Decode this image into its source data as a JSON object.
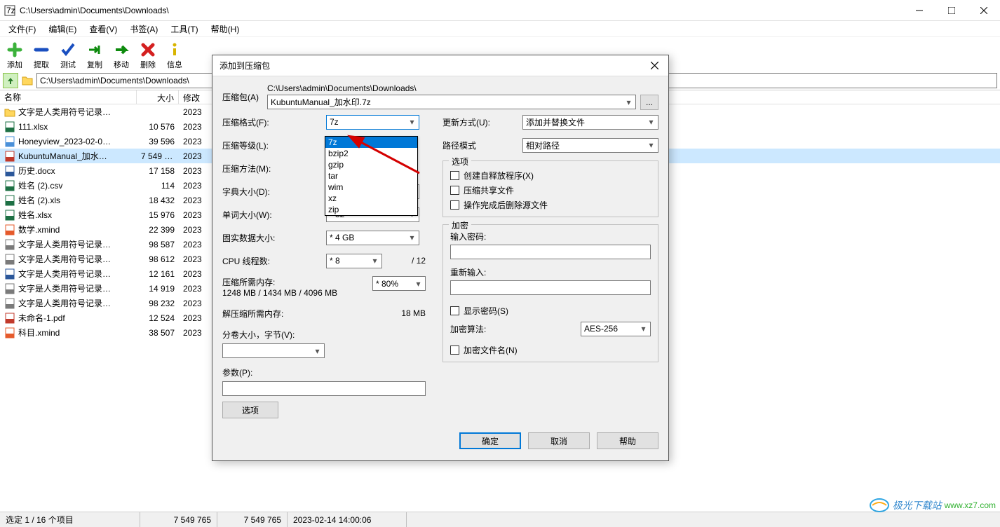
{
  "window": {
    "title": "C:\\Users\\admin\\Documents\\Downloads\\"
  },
  "menubar": [
    {
      "label": "文件(F)"
    },
    {
      "label": "编辑(E)"
    },
    {
      "label": "查看(V)"
    },
    {
      "label": "书签(A)"
    },
    {
      "label": "工具(T)"
    },
    {
      "label": "帮助(H)"
    }
  ],
  "toolbar": [
    {
      "label": "添加",
      "icon": "plus",
      "color": "#3bb13b"
    },
    {
      "label": "提取",
      "icon": "minus",
      "color": "#1a4fc0"
    },
    {
      "label": "测试",
      "icon": "check",
      "color": "#1a4fc0"
    },
    {
      "label": "复制",
      "icon": "copy",
      "color": "#0d8a0d"
    },
    {
      "label": "移动",
      "icon": "move",
      "color": "#0d8a0d"
    },
    {
      "label": "删除",
      "icon": "delete",
      "color": "#d42020"
    },
    {
      "label": "信息",
      "icon": "info",
      "color": "#d8b400"
    }
  ],
  "addressbar": {
    "path": "C:\\Users\\admin\\Documents\\Downloads\\"
  },
  "filelist": {
    "columns": [
      {
        "label": "名称",
        "key": "name"
      },
      {
        "label": "大小",
        "key": "size"
      },
      {
        "label": "修改时间",
        "key": "date"
      }
    ],
    "rows": [
      {
        "name": "文字是人类用符号记录…",
        "size": "",
        "date": "2023",
        "icon": "folder",
        "selected": false
      },
      {
        "name": "111.xlsx",
        "size": "10 576",
        "date": "2023",
        "icon": "xlsx",
        "selected": false
      },
      {
        "name": "Honeyview_2023-02-0…",
        "size": "39 596",
        "date": "2023",
        "icon": "image",
        "selected": false
      },
      {
        "name": "KubuntuManual_加水…",
        "size": "7 549 765",
        "date": "2023",
        "icon": "pdf",
        "selected": true
      },
      {
        "name": "历史.docx",
        "size": "17 158",
        "date": "2023",
        "icon": "docx",
        "selected": false
      },
      {
        "name": "姓名 (2).csv",
        "size": "114",
        "date": "2023",
        "icon": "csv",
        "selected": false
      },
      {
        "name": "姓名 (2).xls",
        "size": "18 432",
        "date": "2023",
        "icon": "xls",
        "selected": false
      },
      {
        "name": "姓名.xlsx",
        "size": "15 976",
        "date": "2023",
        "icon": "xlsx",
        "selected": false
      },
      {
        "name": "数学.xmind",
        "size": "22 399",
        "date": "2023",
        "icon": "xmind",
        "selected": false
      },
      {
        "name": "文字是人类用符号记录…",
        "size": "98 587",
        "date": "2023",
        "icon": "doc",
        "selected": false
      },
      {
        "name": "文字是人类用符号记录…",
        "size": "98 612",
        "date": "2023",
        "icon": "doc",
        "selected": false
      },
      {
        "name": "文字是人类用符号记录…",
        "size": "12 161",
        "date": "2023",
        "icon": "docx",
        "selected": false
      },
      {
        "name": "文字是人类用符号记录…",
        "size": "14 919",
        "date": "2023",
        "icon": "doc",
        "selected": false
      },
      {
        "name": "文字是人类用符号记录…",
        "size": "98 232",
        "date": "2023",
        "icon": "doc",
        "selected": false
      },
      {
        "name": "未命名-1.pdf",
        "size": "12 524",
        "date": "2023",
        "icon": "pdf",
        "selected": false
      },
      {
        "name": "科目.xmind",
        "size": "38 507",
        "date": "2023",
        "icon": "xmind",
        "selected": false
      }
    ]
  },
  "statusbar": {
    "selection": "选定 1 / 16 个项目",
    "size1": "7 549 765",
    "size2": "7 549 765",
    "date": "2023-02-14 14:00:06"
  },
  "dialog": {
    "title": "添加到压缩包",
    "archive_label": "压缩包(A)",
    "archive_path": "C:\\Users\\admin\\Documents\\Downloads\\",
    "archive_name": "KubuntuManual_加水印.7z",
    "browse_label": "...",
    "left": {
      "format_label": "压缩格式(F):",
      "format_value": "7z",
      "format_options": [
        "7z",
        "bzip2",
        "gzip",
        "tar",
        "wim",
        "xz",
        "zip"
      ],
      "level_label": "压缩等级(L):",
      "method_label": "压缩方法(M):",
      "dict_label": "字典大小(D):",
      "dict_value": "",
      "word_label": "单词大小(W):",
      "word_value": "* 32",
      "solid_label": "固实数据大小:",
      "solid_value": "* 4 GB",
      "threads_label": "CPU 线程数:",
      "threads_value": "* 8",
      "threads_max": "/ 12",
      "mem_comp_label": "压缩所需内存:",
      "mem_comp_value": "1248 MB / 1434 MB / 4096 MB",
      "mem_comp_percent": "* 80%",
      "mem_decomp_label": "解压缩所需内存:",
      "mem_decomp_value": "18 MB",
      "split_label": "分卷大小，字节(V):",
      "params_label": "参数(P):",
      "options_btn": "选项"
    },
    "right": {
      "update_label": "更新方式(U):",
      "update_value": "添加并替换文件",
      "pathmode_label": "路径模式",
      "pathmode_value": "相对路径",
      "options_group": "选项",
      "opt_sfx": "创建自释放程序(X)",
      "opt_share": "压缩共享文件",
      "opt_delete": "操作完成后删除源文件",
      "encrypt_group": "加密",
      "pwd_label": "输入密码:",
      "pwd2_label": "重新输入:",
      "show_pwd": "显示密码(S)",
      "enc_method_label": "加密算法:",
      "enc_method_value": "AES-256",
      "enc_names": "加密文件名(N)"
    },
    "buttons": {
      "ok": "确定",
      "cancel": "取消",
      "help": "帮助"
    }
  },
  "watermark": {
    "text": "极光下载站",
    "url": "www.xz7.com"
  }
}
